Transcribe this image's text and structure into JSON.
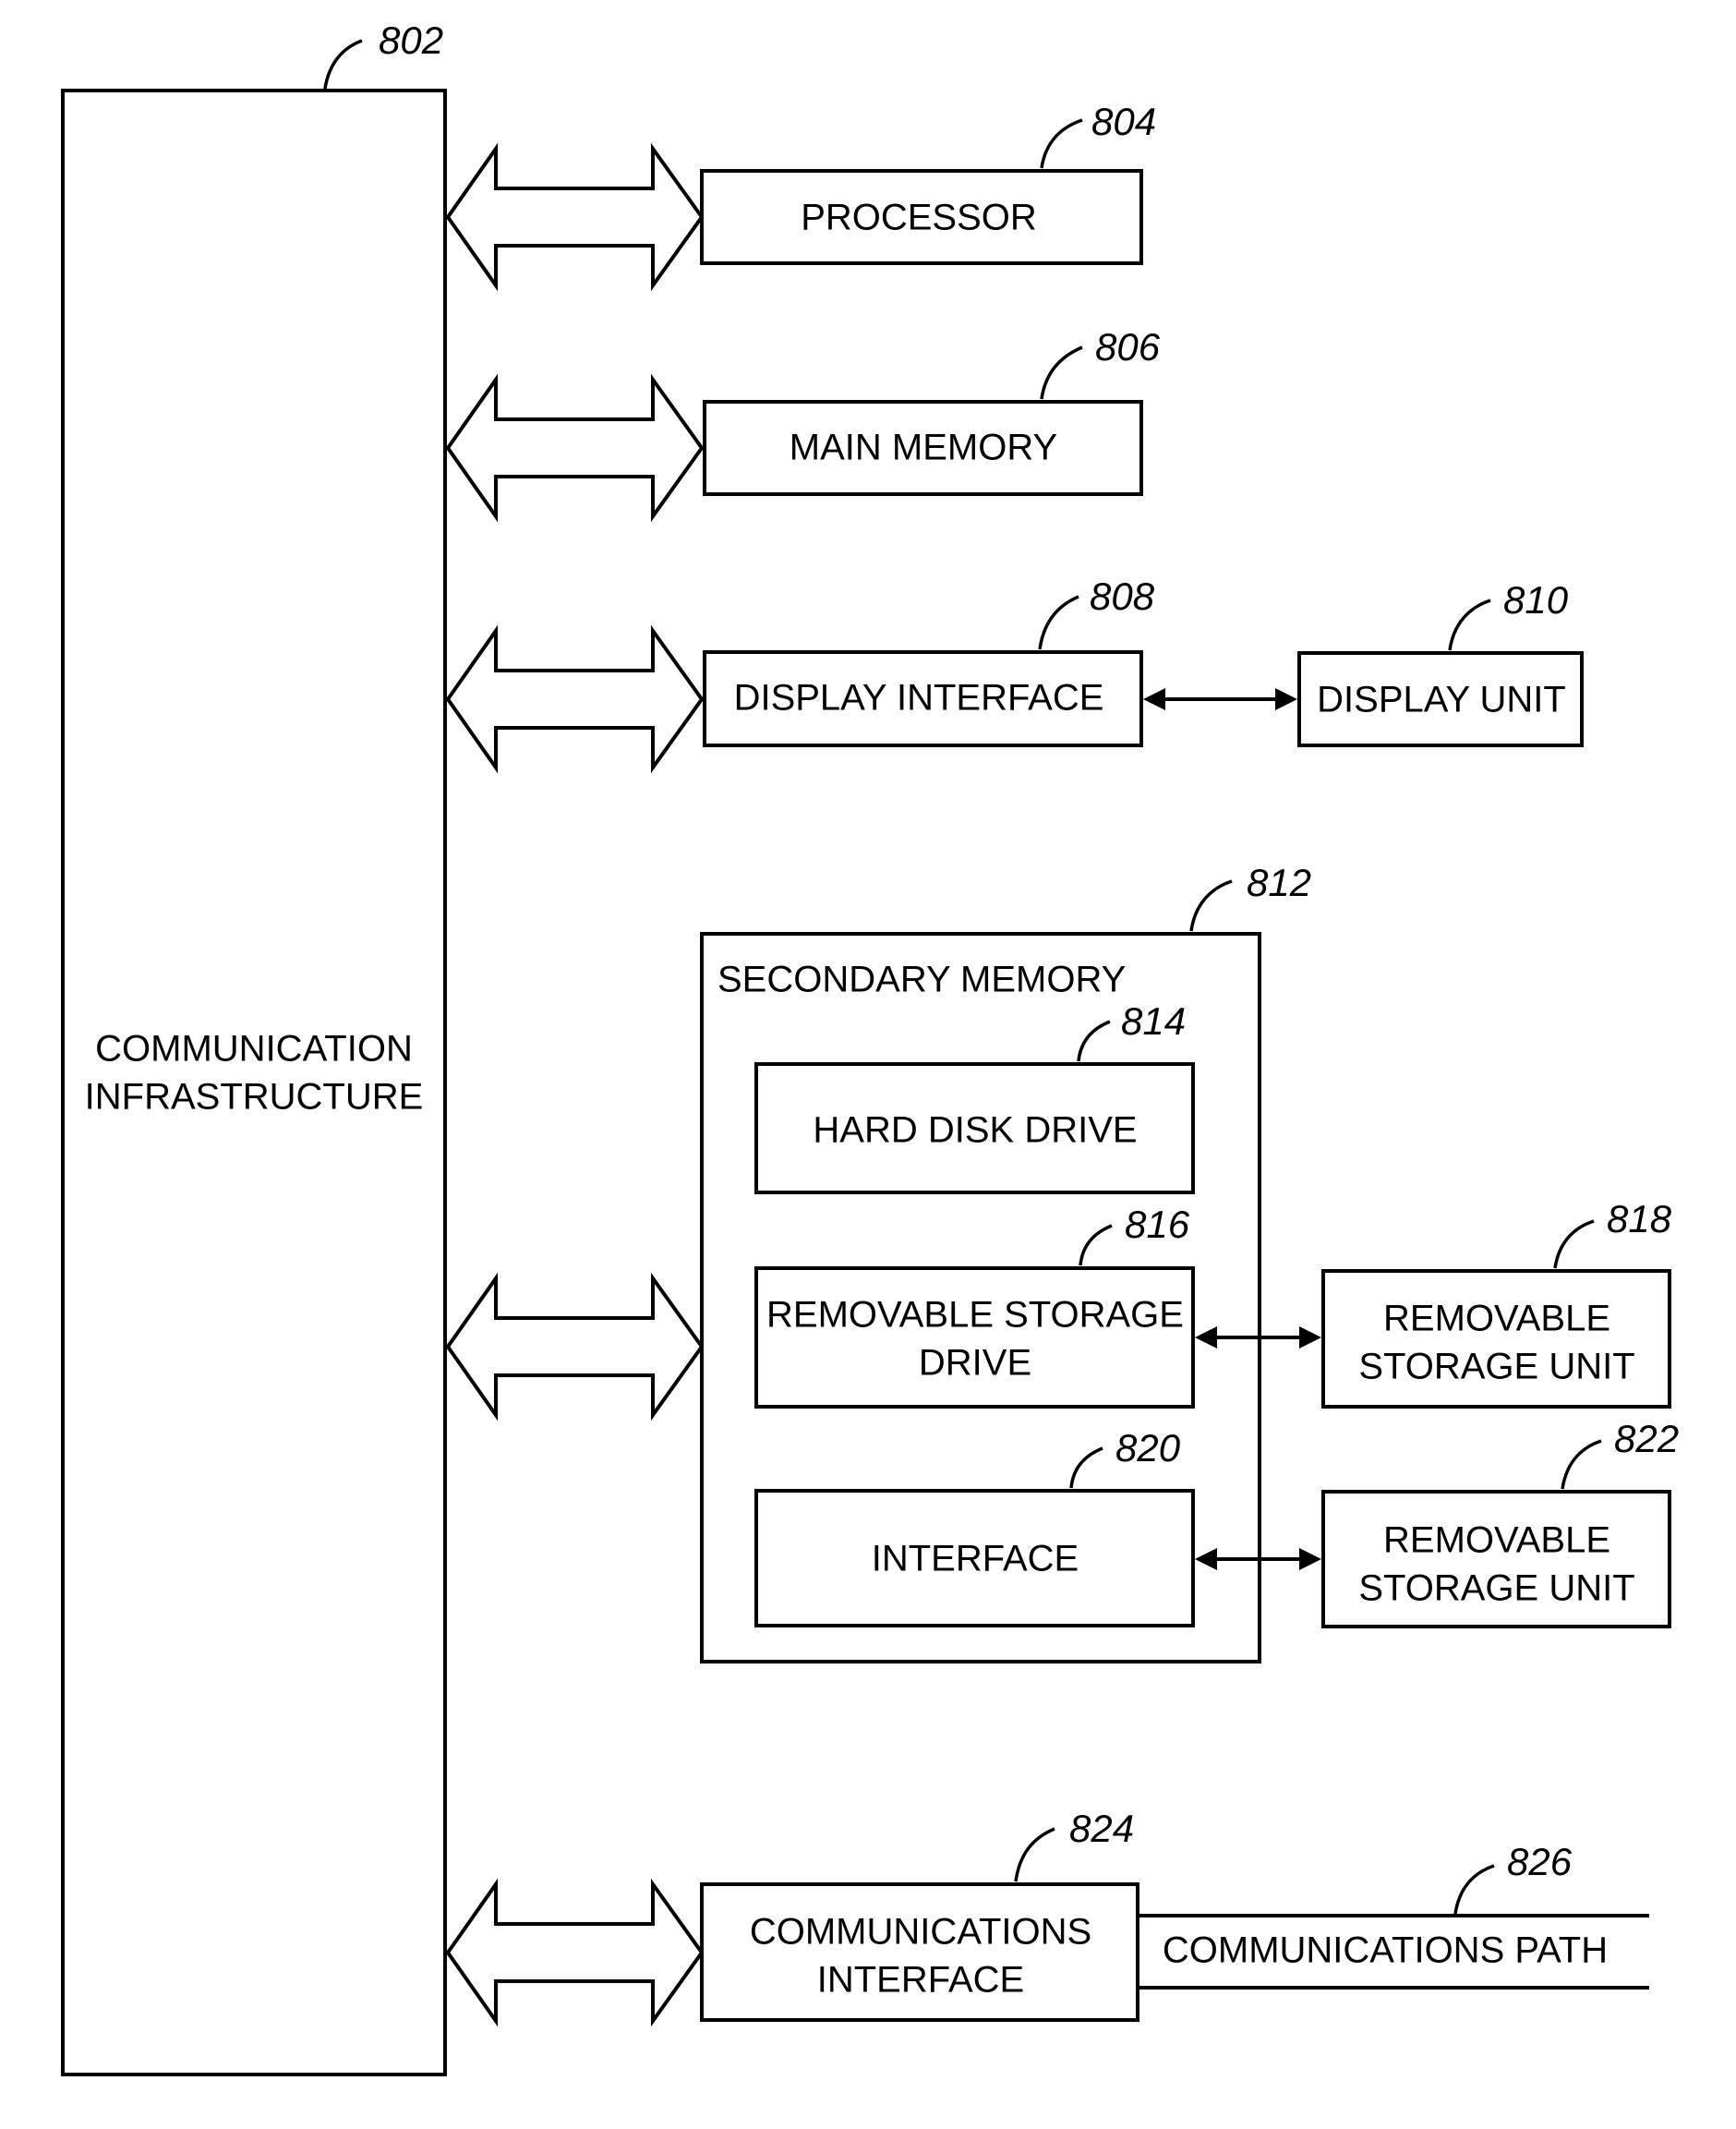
{
  "figure": {
    "blocks": {
      "comm_infra": {
        "ref": "802",
        "lines": [
          "COMMUNICATION",
          "INFRASTRUCTURE"
        ]
      },
      "processor": {
        "ref": "804",
        "lines": [
          "PROCESSOR"
        ]
      },
      "main_memory": {
        "ref": "806",
        "lines": [
          "MAIN MEMORY"
        ]
      },
      "display_interface": {
        "ref": "808",
        "lines": [
          "DISPLAY INTERFACE"
        ]
      },
      "display_unit": {
        "ref": "810",
        "lines": [
          "DISPLAY UNIT"
        ]
      },
      "secondary_memory": {
        "ref": "812",
        "lines": [
          "SECONDARY MEMORY"
        ]
      },
      "hard_disk_drive": {
        "ref": "814",
        "lines": [
          "HARD DISK DRIVE"
        ]
      },
      "removable_storage_drive": {
        "ref": "816",
        "lines": [
          "REMOVABLE STORAGE",
          "DRIVE"
        ]
      },
      "removable_storage_unit_1": {
        "ref": "818",
        "lines": [
          "REMOVABLE",
          "STORAGE UNIT"
        ]
      },
      "interface": {
        "ref": "820",
        "lines": [
          "INTERFACE"
        ]
      },
      "removable_storage_unit_2": {
        "ref": "822",
        "lines": [
          "REMOVABLE",
          "STORAGE UNIT"
        ]
      },
      "comms_interface": {
        "ref": "824",
        "lines": [
          "COMMUNICATIONS",
          "INTERFACE"
        ]
      },
      "comms_path": {
        "ref": "826",
        "lines": [
          "COMMUNICATIONS PATH"
        ]
      }
    },
    "connections": [
      {
        "from": "comm_infra",
        "to": "processor",
        "type": "bus-double-arrow"
      },
      {
        "from": "comm_infra",
        "to": "main_memory",
        "type": "bus-double-arrow"
      },
      {
        "from": "comm_infra",
        "to": "display_interface",
        "type": "bus-double-arrow"
      },
      {
        "from": "comm_infra",
        "to": "secondary_memory",
        "type": "bus-double-arrow"
      },
      {
        "from": "comm_infra",
        "to": "comms_interface",
        "type": "bus-double-arrow"
      },
      {
        "from": "display_interface",
        "to": "display_unit",
        "type": "bidirectional-arrow"
      },
      {
        "from": "removable_storage_drive",
        "to": "removable_storage_unit_1",
        "type": "bidirectional-arrow"
      },
      {
        "from": "interface",
        "to": "removable_storage_unit_2",
        "type": "bidirectional-arrow"
      },
      {
        "from": "comms_interface",
        "to": "comms_path",
        "type": "channel"
      }
    ]
  }
}
